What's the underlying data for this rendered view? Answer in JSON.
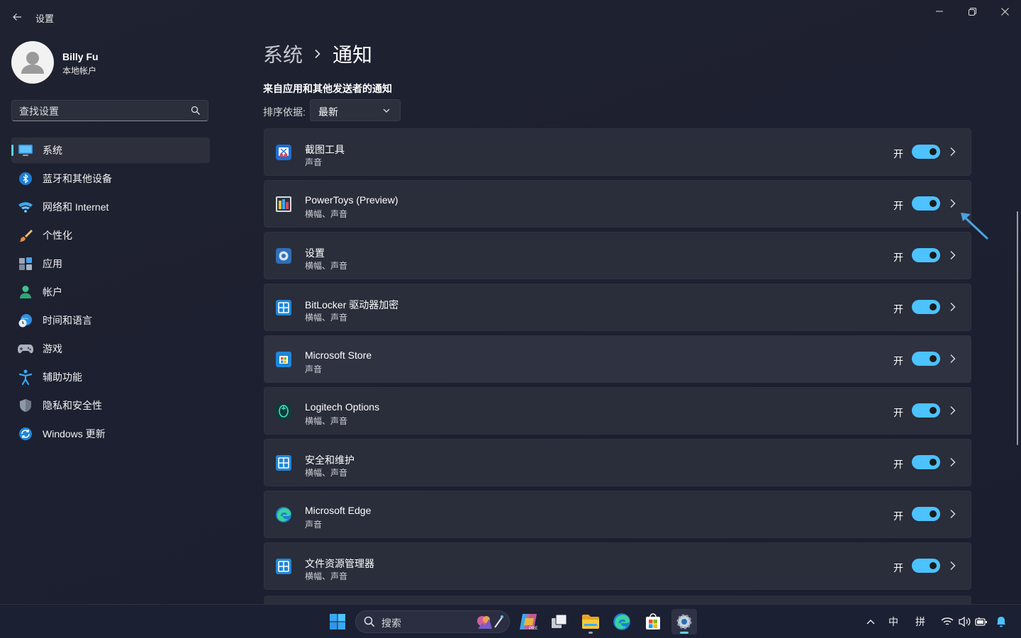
{
  "window": {
    "title": "设置"
  },
  "profile": {
    "name": "Billy Fu",
    "account_type": "本地帐户"
  },
  "search": {
    "placeholder": "查找设置"
  },
  "nav": {
    "items": [
      {
        "label": "系统",
        "icon": "monitor-icon",
        "active": true
      },
      {
        "label": "蓝牙和其他设备",
        "icon": "bluetooth-icon"
      },
      {
        "label": "网络和 Internet",
        "icon": "wifi-icon"
      },
      {
        "label": "个性化",
        "icon": "paintbrush-icon"
      },
      {
        "label": "应用",
        "icon": "apps-icon"
      },
      {
        "label": "帐户",
        "icon": "person-icon"
      },
      {
        "label": "时间和语言",
        "icon": "clock-globe-icon"
      },
      {
        "label": "游戏",
        "icon": "gamepad-icon"
      },
      {
        "label": "辅助功能",
        "icon": "accessibility-icon"
      },
      {
        "label": "隐私和安全性",
        "icon": "shield-icon"
      },
      {
        "label": "Windows 更新",
        "icon": "update-icon"
      }
    ]
  },
  "breadcrumb": {
    "parent": "系统",
    "current": "通知"
  },
  "section": {
    "title": "来自应用和其他发送者的通知",
    "sort_label": "排序依据:",
    "sort_value": "最新"
  },
  "apps": [
    {
      "name": "截图工具",
      "sub": "声音",
      "state": "开",
      "icon": "snipping-tool-icon"
    },
    {
      "name": "PowerToys (Preview)",
      "sub": "横幅、声音",
      "state": "开",
      "icon": "powertoys-icon"
    },
    {
      "name": "设置",
      "sub": "横幅、声音",
      "state": "开",
      "icon": "settings-gear-icon"
    },
    {
      "name": "BitLocker 驱动器加密",
      "sub": "横幅、声音",
      "state": "开",
      "icon": "windows-app-icon"
    },
    {
      "name": "Microsoft Store",
      "sub": "声音",
      "state": "开",
      "icon": "store-icon"
    },
    {
      "name": "Logitech Options",
      "sub": "横幅、声音",
      "state": "开",
      "icon": "logitech-icon"
    },
    {
      "name": "安全和维护",
      "sub": "横幅、声音",
      "state": "开",
      "icon": "windows-app-icon"
    },
    {
      "name": "Microsoft Edge",
      "sub": "声音",
      "state": "开",
      "icon": "edge-icon"
    },
    {
      "name": "文件资源管理器",
      "sub": "横幅、声音",
      "state": "开",
      "icon": "windows-app-icon"
    }
  ],
  "taskbar": {
    "search_text": "搜索",
    "ime_language": "中",
    "ime_mode": "拼"
  },
  "colors": {
    "accent": "#4cc2ff",
    "background": "#1e2130",
    "card": "#2a2d3a"
  }
}
